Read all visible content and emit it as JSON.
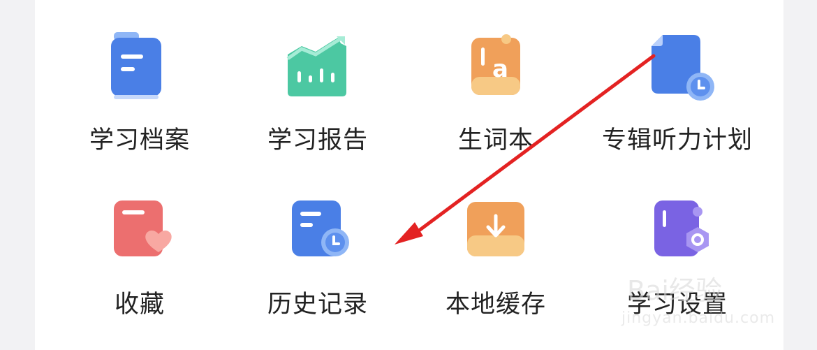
{
  "menu": {
    "items": [
      {
        "id": "study-profile",
        "label": "学习档案",
        "icon": "clipboard-icon"
      },
      {
        "id": "study-report",
        "label": "学习报告",
        "icon": "chart-icon"
      },
      {
        "id": "vocabulary",
        "label": "生词本",
        "icon": "vocabulary-book-icon"
      },
      {
        "id": "album-listening-plan",
        "label": "专辑听力计划",
        "icon": "document-clock-icon"
      },
      {
        "id": "favorites",
        "label": "收藏",
        "icon": "heart-note-icon"
      },
      {
        "id": "history",
        "label": "历史记录",
        "icon": "history-clock-icon"
      },
      {
        "id": "local-cache",
        "label": "本地缓存",
        "icon": "download-box-icon"
      },
      {
        "id": "study-settings",
        "label": "学习设置",
        "icon": "settings-book-icon"
      }
    ]
  },
  "colors": {
    "blue": "#4a7fe6",
    "green": "#4cc8a2",
    "orange": "#f0a05a",
    "red": "#ec6f6f",
    "purple": "#7a63e3",
    "arrow": "#e32222"
  },
  "watermark": {
    "text": "Bai经验",
    "url": "jingyan.baidu.com"
  }
}
